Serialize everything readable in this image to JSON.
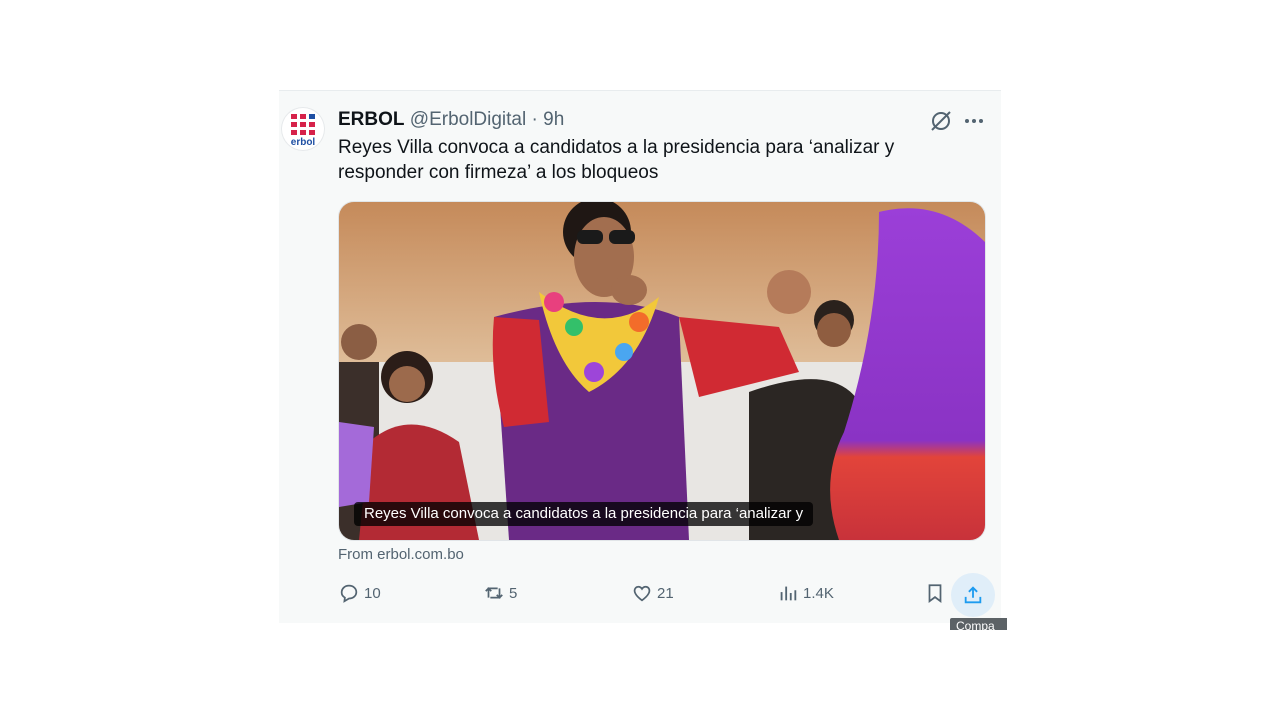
{
  "post": {
    "author_name": "ERBOL",
    "handle": "@ErbolDigital",
    "separator": "·",
    "time": "9h",
    "avatar_text": "erbol",
    "text": "Reyes Villa convoca a candidatos a la presidencia para ‘analizar y responder con firmeza’ a los bloqueos",
    "media_caption": "Reyes Villa convoca a candidatos a la presidencia para ‘analizar y",
    "source": "From erbol.com.bo"
  },
  "actions": {
    "replies": "10",
    "reposts": "5",
    "likes": "21",
    "views": "1.4K"
  },
  "tooltip": "Compa",
  "icons": {
    "grok": "grok-icon",
    "more": "more-icon",
    "reply": "reply-icon",
    "repost": "repost-icon",
    "like": "heart-icon",
    "views": "bar-chart-icon",
    "bookmark": "bookmark-icon",
    "share": "share-icon"
  },
  "colors": {
    "accent": "#1d9bf0",
    "muted": "#536471",
    "brand_red": "#d6224a",
    "brand_blue": "#1e4fa3"
  }
}
